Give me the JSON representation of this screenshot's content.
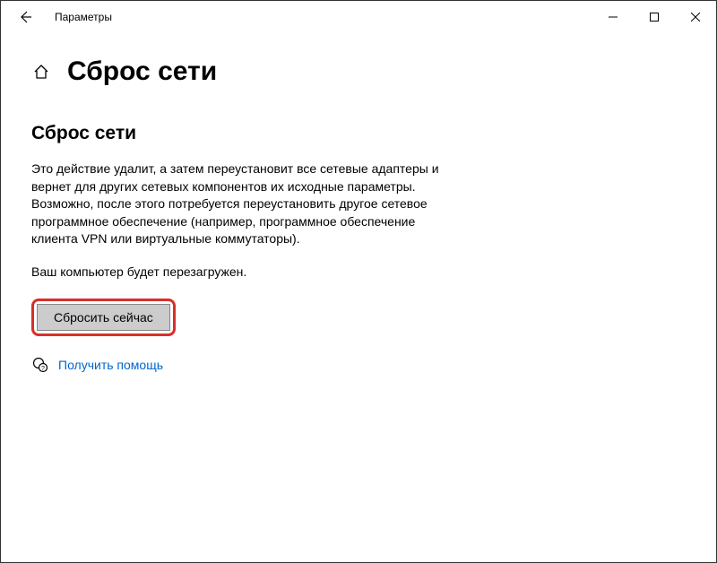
{
  "titlebar": {
    "title": "Параметры"
  },
  "page": {
    "title": "Сброс сети",
    "section_title": "Сброс сети",
    "description": "Это действие удалит, а затем переустановит все сетевые адаптеры и вернет для других сетевых компонентов их исходные параметры. Возможно, после этого потребуется переустановить другое сетевое программное обеспечение (например, программное обеспечение клиента VPN или виртуальные коммутаторы).",
    "warning": "Ваш компьютер будет перезагружен.",
    "reset_button": "Сбросить сейчас",
    "help_link": "Получить помощь"
  }
}
